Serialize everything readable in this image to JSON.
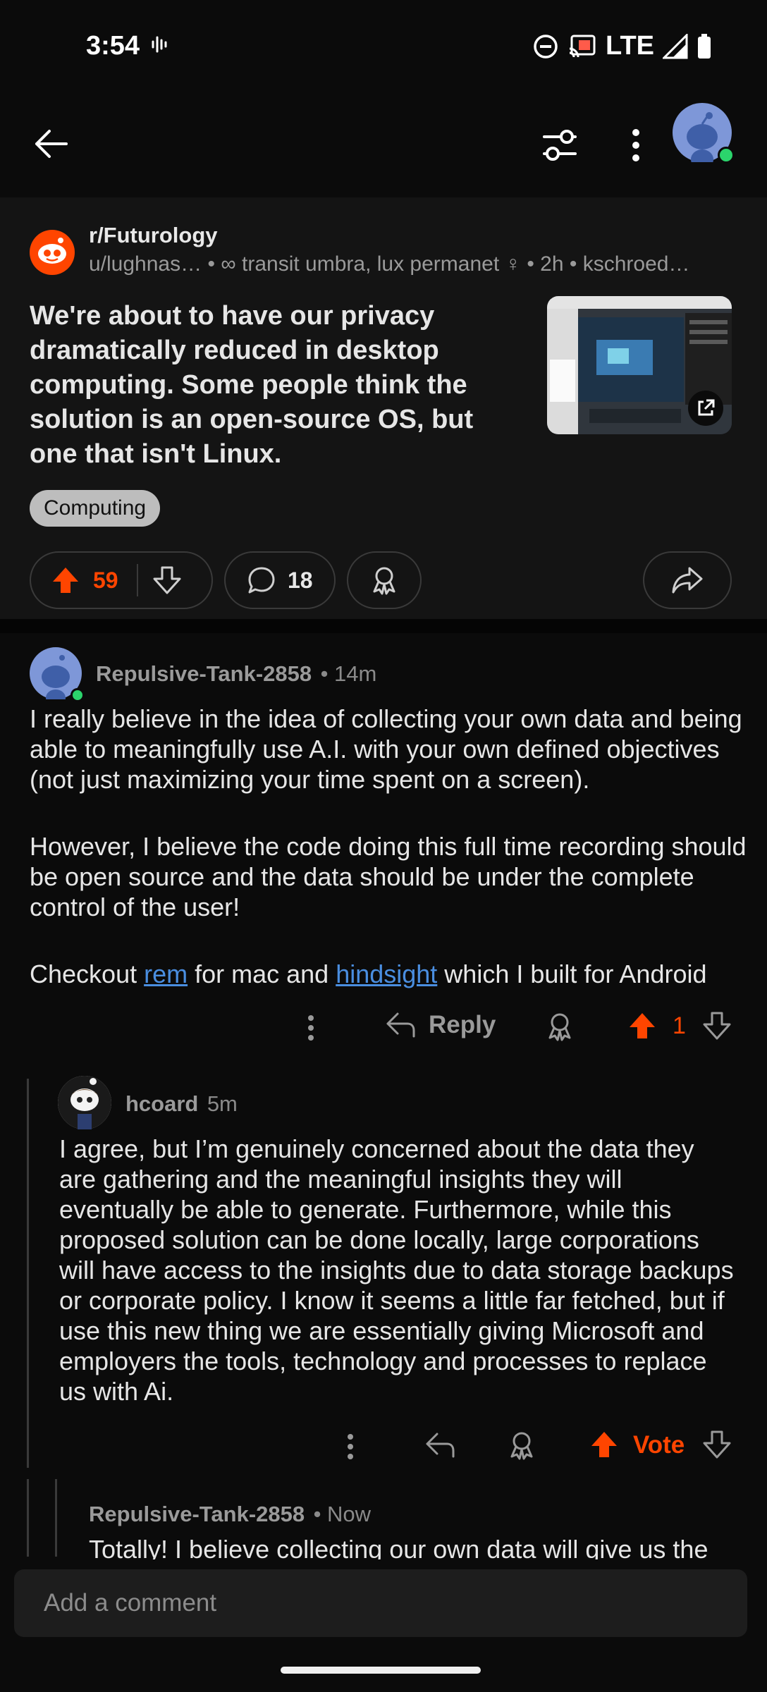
{
  "status": {
    "time": "3:54",
    "network": "LTE"
  },
  "post": {
    "subreddit": "r/Futurology",
    "meta": "u/lughnas… • ∞ transit umbra, lux permanet ♀ • 2h • kschroed…",
    "title": "We're about to have our privacy dramatically reduced in desktop computing. Some people think the solution is an open-source OS, but one that isn't Linux.",
    "flair": "Computing",
    "upvotes": "59",
    "comments": "18"
  },
  "comments": [
    {
      "user": "Repulsive-Tank-2858",
      "time": "• 14m",
      "para1": "I really believe in the idea of collecting your own data and being able to meaningfully use A.I. with your own defined objectives (not just maximizing your time spent on a screen).",
      "para2": "However, I believe the code doing this full time recording should be open source and the data should be under the complete control of the user!",
      "para3_a": "Checkout ",
      "link1": "rem",
      "para3_b": " for mac and ",
      "link2": "hindsight",
      "para3_c": " which I built for Android",
      "reply_label": "Reply",
      "score": "1"
    },
    {
      "user": "hcoard",
      "time": "5m",
      "body": "I agree, but I’m genuinely concerned about the data they are gathering and the meaningful insights they will eventually be able to generate. Furthermore, while this proposed solution can be done locally, large corporations will have access to the insights due to data storage backups or corporate policy. I know it seems a little far fetched, but if use this new thing we are essentially giving Microsoft and employers the tools, technology and processes to replace us with Ai.",
      "vote_label": "Vote"
    },
    {
      "user": "Repulsive-Tank-2858",
      "time": "• Now",
      "body": "Totally! I believe collecting our own data will give us the"
    }
  ],
  "composer": {
    "placeholder": "Add a comment"
  },
  "colors": {
    "accent": "#ff4500",
    "link": "#4a8ee0",
    "background": "#0b0b0b",
    "card": "#141414"
  }
}
